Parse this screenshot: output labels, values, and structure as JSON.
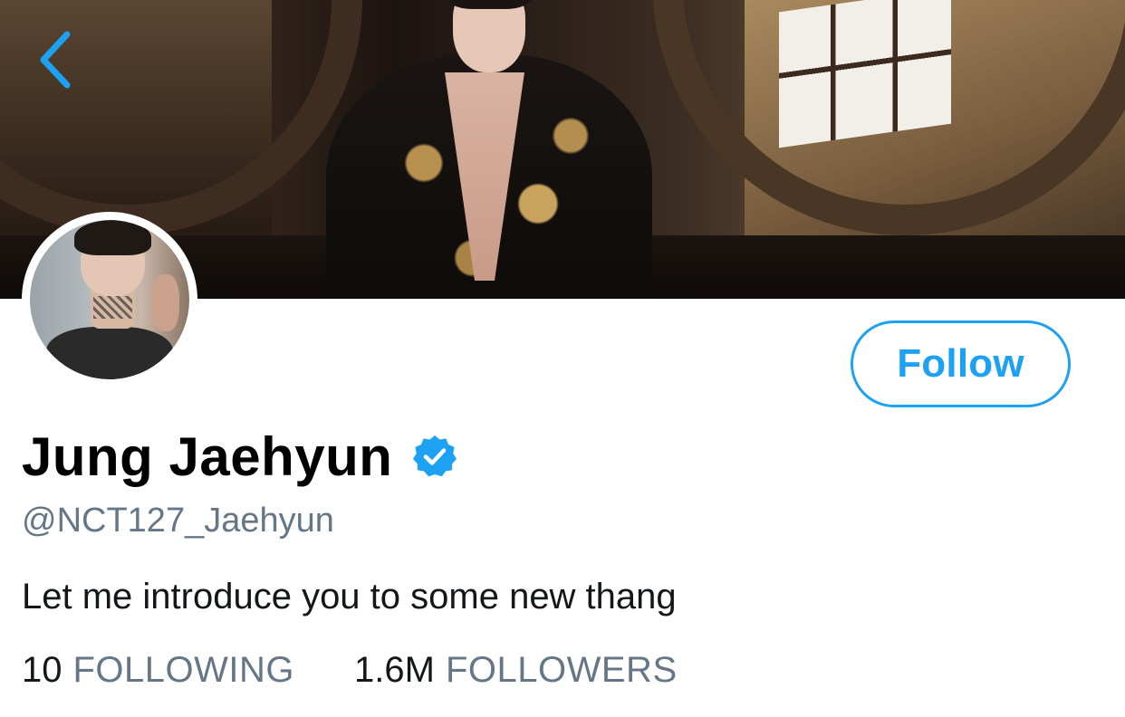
{
  "profile": {
    "display_name": "Jung Jaehyun",
    "handle": "@NCT127_Jaehyun",
    "bio": "Let me introduce you to some new thang",
    "verified": true
  },
  "actions": {
    "follow_label": "Follow"
  },
  "stats": {
    "following_count": "10",
    "following_label": "FOLLOWING",
    "followers_count": "1.6M",
    "followers_label": "FOLLOWERS"
  },
  "icons": {
    "back": "back-chevron-icon",
    "verified": "verified-badge-icon"
  },
  "colors": {
    "accent": "#1da1f2",
    "muted_text": "#657786",
    "primary_text": "#14171a"
  }
}
